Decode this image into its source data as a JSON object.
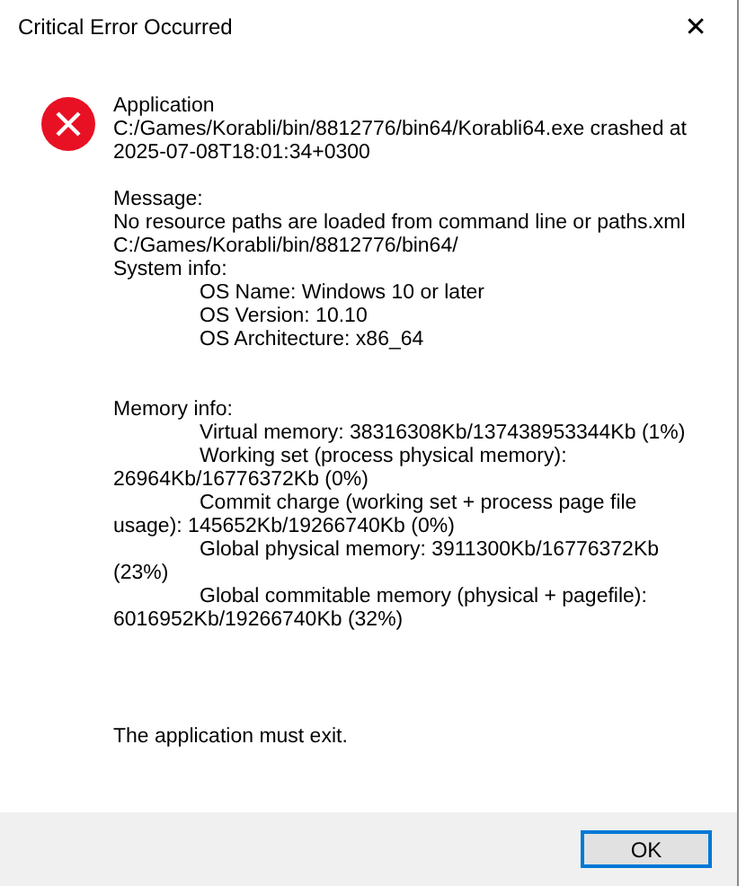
{
  "window": {
    "title": "Critical Error Occurred",
    "close_glyph": "✕"
  },
  "message": {
    "sections": [
      {
        "lines": [
          "Application",
          "C:/Games/Korabli/bin/8812776/bin64/Korabli64.exe crashed at",
          "2025-07-08T18:01:34+0300"
        ]
      },
      {
        "lines": [
          "Message:",
          "No resource paths are loaded from command line or paths.xml",
          "C:/Games/Korabli/bin/8812776/bin64/",
          "System info:",
          "\tOS Name: Windows 10 or later",
          "\tOS Version: 10.10",
          "\tOS Architecture: x86_64"
        ]
      },
      {
        "lines": [
          "Memory info:",
          "\tVirtual memory: 38316308Kb/137438953344Kb (1%)",
          "\tWorking set (process physical memory):",
          "26964Kb/16776372Kb (0%)",
          "\tCommit charge (working set + process page file",
          "usage): 145652Kb/19266740Kb (0%)",
          "\tGlobal physical memory: 3911300Kb/16776372Kb",
          "(23%)",
          "\tGlobal commitable memory (physical + pagefile):",
          "6016952Kb/19266740Kb (32%)"
        ]
      }
    ],
    "footer": "The application must exit."
  },
  "buttons": [
    {
      "label": "OK",
      "focused": true
    }
  ]
}
